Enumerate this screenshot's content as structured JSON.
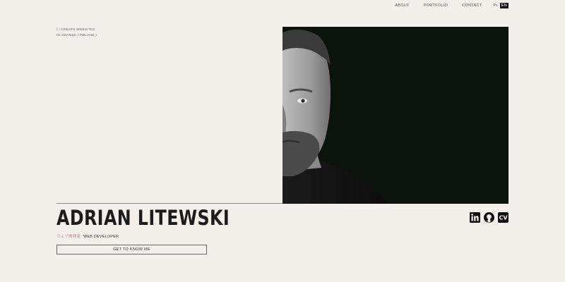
{
  "nav": {
    "items": [
      "ABOUT",
      "PORTFOLIO",
      "CONTACT"
    ],
    "languages": [
      "PL",
      "EN"
    ],
    "active_language": "EN"
  },
  "hero": {
    "tagline_line1": "( I CREATE WEBSITES",
    "tagline_line2": "IN GDANSK / POLAND )",
    "name": "ADRIAN LITEWSKI",
    "subtitle_jp": "ウェブ開発者",
    "subtitle_role": "WEB DEVELOPER",
    "cta_label": "GET TO KNOW ME"
  },
  "social": {
    "icons": [
      "linkedin-icon",
      "github-icon",
      "cv-icon"
    ],
    "cv_label": "CV"
  },
  "colors": {
    "background": "#f3f0ec",
    "photo_background": "#0b130d",
    "text": "#1f1f1f",
    "accent_jp": "#c98a8a"
  }
}
